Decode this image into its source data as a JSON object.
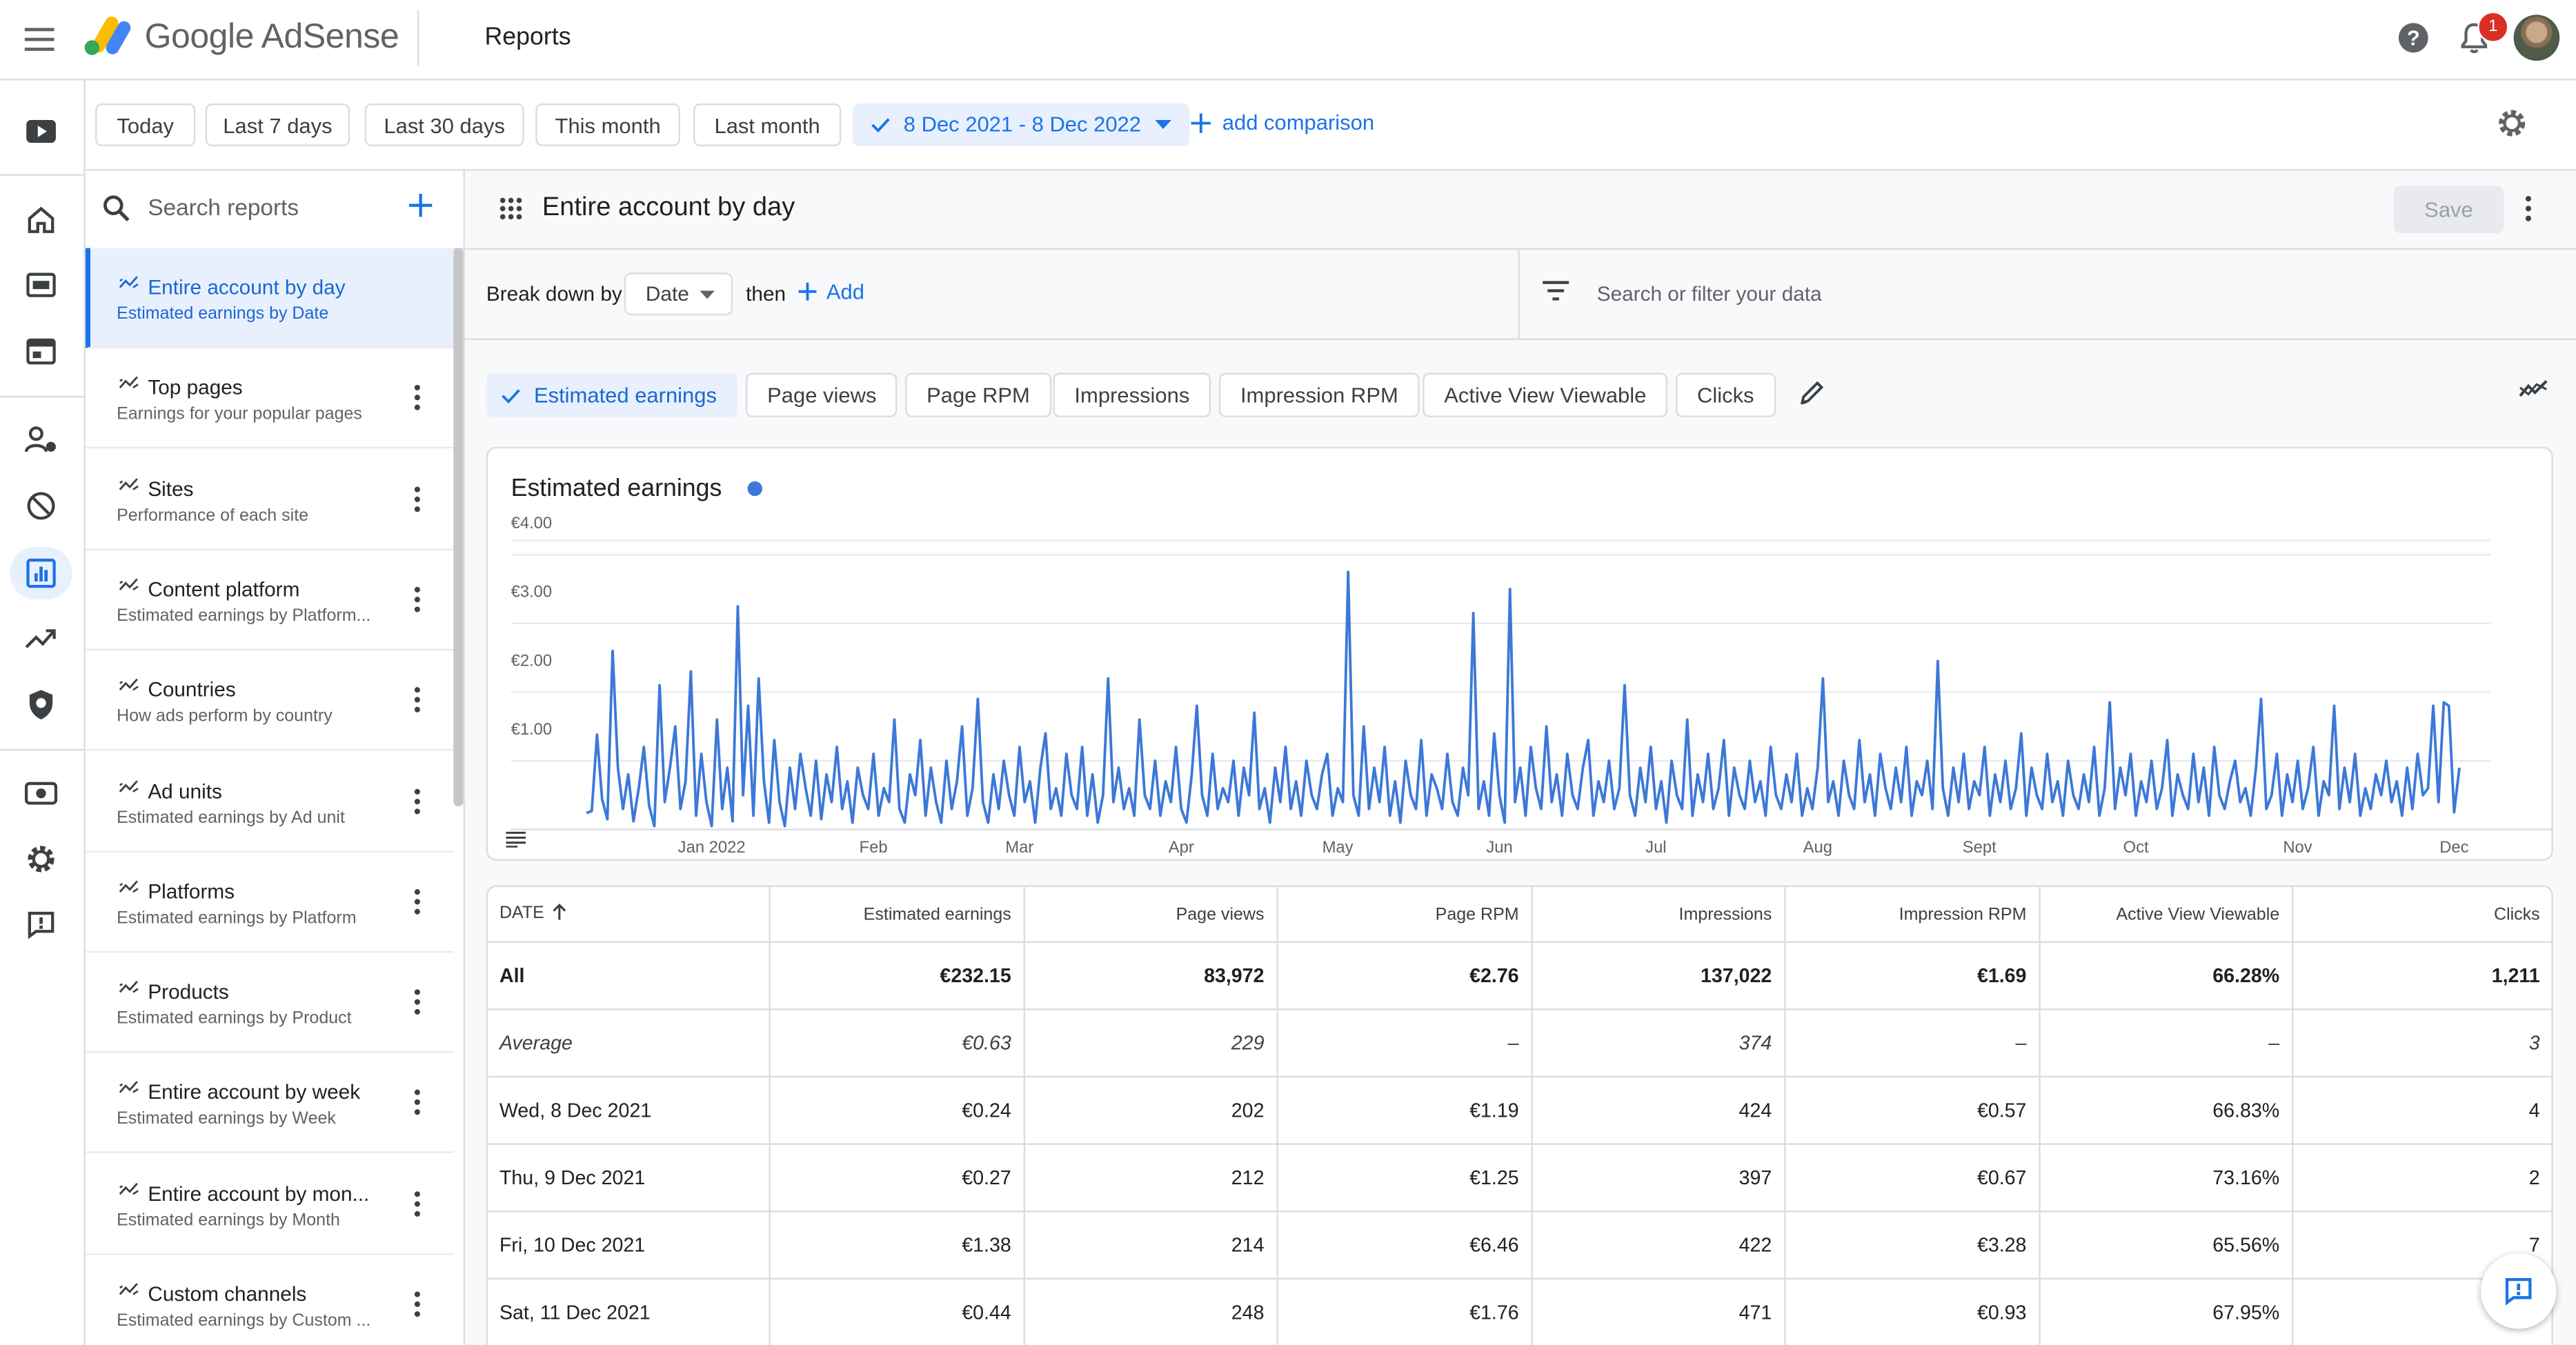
{
  "app": {
    "brand": "Google AdSense",
    "page_title": "Reports",
    "notification_count": "1"
  },
  "rail": {
    "items": [
      "youtube-icon",
      "home-icon",
      "ad-screen-icon",
      "sites-icon",
      "privacy-messaging-icon",
      "blocking-controls-icon",
      "reports-icon",
      "optimization-icon",
      "policy-center-icon",
      "payments-icon",
      "settings-icon",
      "feedback-icon"
    ],
    "active": "reports-icon"
  },
  "datebar": {
    "presets": [
      "Today",
      "Last 7 days",
      "Last 30 days",
      "This month",
      "Last month"
    ],
    "selected_range": "8 Dec 2021 - 8 Dec 2022",
    "add_comparison": "add comparison"
  },
  "reports": {
    "search_placeholder": "Search reports",
    "items": [
      {
        "title": "Entire account by day",
        "subtitle": "Estimated earnings by Date"
      },
      {
        "title": "Top pages",
        "subtitle": "Earnings for your popular pages"
      },
      {
        "title": "Sites",
        "subtitle": "Performance of each site"
      },
      {
        "title": "Content platform",
        "subtitle": "Estimated earnings by Platform..."
      },
      {
        "title": "Countries",
        "subtitle": "How ads perform by country"
      },
      {
        "title": "Ad units",
        "subtitle": "Estimated earnings by Ad unit"
      },
      {
        "title": "Platforms",
        "subtitle": "Estimated earnings by Platform"
      },
      {
        "title": "Products",
        "subtitle": "Estimated earnings by Product"
      },
      {
        "title": "Entire account by week",
        "subtitle": "Estimated earnings by Week"
      },
      {
        "title": "Entire account by mon...",
        "subtitle": "Estimated earnings by Month"
      },
      {
        "title": "Custom channels",
        "subtitle": "Estimated earnings by Custom ..."
      }
    ]
  },
  "report": {
    "name": "Entire account by day",
    "save_label": "Save",
    "breakdown_label": "Break down by",
    "breakdown_value": "Date",
    "then_label": "then",
    "add_label": "Add",
    "filter_placeholder": "Search or filter your data",
    "metrics": [
      "Estimated earnings",
      "Page views",
      "Page RPM",
      "Impressions",
      "Impression RPM",
      "Active View Viewable",
      "Clicks"
    ]
  },
  "chart_data": {
    "type": "line",
    "title": "Estimated earnings",
    "series_color": "#3c78d8",
    "ytick_labels": [
      "€1.00",
      "€2.00",
      "€3.00",
      "€4.00"
    ],
    "ylim": [
      0,
      4.4
    ],
    "xtick_labels": [
      "Jan 2022",
      "Feb",
      "Mar",
      "Apr",
      "May",
      "Jun",
      "Jul",
      "Aug",
      "Sept",
      "Oct",
      "Nov",
      "Dec"
    ],
    "xtick_days": [
      24,
      55,
      83,
      114,
      144,
      175,
      205,
      236,
      267,
      297,
      328,
      358
    ],
    "x_start": "2021-12-08",
    "x_end": "2022-12-08",
    "values": [
      0.24,
      0.27,
      1.38,
      0.44,
      0.15,
      2.6,
      0.9,
      0.3,
      0.8,
      0.12,
      0.6,
      1.2,
      0.35,
      0.05,
      2.1,
      0.4,
      0.9,
      1.5,
      0.3,
      0.7,
      2.3,
      0.2,
      1.1,
      0.4,
      0.05,
      1.6,
      0.3,
      0.9,
      0.12,
      3.25,
      0.5,
      1.8,
      0.2,
      2.2,
      0.7,
      0.1,
      1.3,
      0.4,
      0.05,
      0.9,
      0.3,
      1.1,
      0.6,
      0.2,
      1.0,
      0.15,
      0.8,
      0.4,
      1.2,
      0.3,
      0.7,
      0.1,
      0.9,
      0.5,
      0.3,
      1.1,
      0.2,
      0.6,
      0.4,
      1.6,
      0.3,
      0.1,
      0.8,
      0.5,
      1.3,
      0.2,
      0.9,
      0.4,
      0.1,
      1.0,
      0.3,
      0.7,
      1.5,
      0.2,
      0.6,
      1.9,
      0.4,
      0.1,
      0.8,
      0.3,
      1.0,
      0.5,
      0.2,
      1.2,
      0.4,
      0.7,
      0.1,
      0.9,
      1.4,
      0.3,
      0.6,
      0.2,
      1.1,
      0.5,
      0.3,
      1.2,
      0.2,
      0.8,
      0.1,
      0.5,
      2.2,
      0.4,
      0.9,
      0.3,
      0.6,
      0.2,
      1.6,
      0.5,
      0.3,
      1.0,
      0.2,
      0.7,
      0.4,
      1.2,
      0.3,
      0.1,
      0.8,
      1.8,
      0.5,
      0.2,
      1.1,
      0.3,
      0.6,
      0.4,
      1.0,
      0.2,
      0.9,
      0.5,
      1.7,
      0.3,
      0.6,
      0.1,
      0.9,
      0.4,
      1.2,
      0.3,
      0.7,
      0.2,
      1.0,
      0.5,
      0.3,
      0.8,
      1.1,
      0.2,
      0.6,
      0.4,
      3.75,
      0.5,
      0.2,
      1.5,
      0.3,
      0.9,
      0.4,
      1.2,
      0.2,
      0.7,
      0.1,
      1.0,
      0.5,
      0.3,
      1.3,
      0.2,
      0.8,
      0.6,
      0.3,
      1.1,
      0.4,
      0.2,
      0.9,
      0.5,
      3.15,
      0.3,
      0.7,
      0.2,
      1.4,
      0.5,
      0.1,
      3.5,
      0.4,
      0.9,
      0.2,
      1.2,
      0.6,
      0.3,
      1.5,
      0.4,
      0.8,
      0.2,
      1.1,
      0.5,
      0.3,
      0.9,
      1.3,
      0.2,
      0.7,
      0.4,
      1.0,
      0.3,
      0.6,
      2.1,
      0.5,
      0.2,
      0.9,
      0.4,
      1.2,
      0.3,
      0.7,
      0.1,
      1.0,
      0.5,
      0.3,
      1.6,
      0.2,
      0.8,
      0.4,
      1.1,
      0.3,
      0.6,
      1.3,
      0.2,
      0.9,
      0.5,
      0.3,
      1.0,
      0.4,
      0.7,
      0.2,
      1.2,
      0.5,
      0.3,
      0.8,
      0.4,
      1.1,
      0.2,
      0.6,
      0.3,
      0.9,
      2.2,
      0.4,
      0.7,
      0.2,
      1.0,
      0.5,
      0.3,
      1.3,
      0.4,
      0.8,
      0.2,
      1.1,
      0.6,
      0.3,
      0.9,
      0.4,
      1.2,
      0.2,
      0.7,
      0.5,
      1.0,
      0.3,
      2.45,
      0.6,
      0.2,
      0.9,
      0.4,
      1.1,
      0.3,
      0.7,
      0.5,
      1.2,
      0.2,
      0.8,
      0.4,
      1.0,
      0.3,
      0.6,
      1.4,
      0.2,
      0.9,
      0.5,
      0.3,
      1.1,
      0.4,
      0.7,
      0.2,
      1.0,
      0.5,
      0.3,
      0.8,
      0.4,
      1.2,
      0.2,
      0.6,
      1.85,
      0.3,
      0.9,
      0.5,
      1.1,
      0.2,
      0.7,
      0.4,
      1.0,
      0.3,
      0.6,
      1.3,
      0.2,
      0.8,
      0.5,
      0.3,
      1.1,
      0.4,
      0.9,
      0.2,
      1.2,
      0.5,
      0.3,
      0.7,
      1.0,
      0.4,
      0.6,
      0.2,
      0.9,
      1.9,
      0.3,
      0.5,
      1.1,
      0.2,
      0.8,
      0.4,
      1.0,
      0.3,
      0.6,
      1.2,
      0.2,
      0.7,
      0.5,
      1.8,
      0.3,
      0.9,
      0.4,
      1.1,
      0.2,
      0.6,
      0.3,
      0.8,
      0.5,
      1.0,
      0.4,
      0.7,
      0.2,
      0.9,
      0.3,
      1.1,
      0.5,
      0.6,
      1.8,
      0.4,
      1.85,
      1.8,
      0.25,
      0.9
    ]
  },
  "table": {
    "columns": [
      "DATE",
      "Estimated earnings",
      "Page views",
      "Page RPM",
      "Impressions",
      "Impression RPM",
      "Active View Viewable",
      "Clicks"
    ],
    "rows": [
      [
        "All",
        "€232.15",
        "83,972",
        "€2.76",
        "137,022",
        "€1.69",
        "66.28%",
        "1,211"
      ],
      [
        "Average",
        "€0.63",
        "229",
        "–",
        "374",
        "–",
        "–",
        "3"
      ],
      [
        "Wed, 8 Dec 2021",
        "€0.24",
        "202",
        "€1.19",
        "424",
        "€0.57",
        "66.83%",
        "4"
      ],
      [
        "Thu, 9 Dec 2021",
        "€0.27",
        "212",
        "€1.25",
        "397",
        "€0.67",
        "73.16%",
        "2"
      ],
      [
        "Fri, 10 Dec 2021",
        "€1.38",
        "214",
        "€6.46",
        "422",
        "€3.28",
        "65.56%",
        "7"
      ],
      [
        "Sat, 11 Dec 2021",
        "€0.44",
        "248",
        "€1.76",
        "471",
        "€0.93",
        "67.95%",
        "1"
      ]
    ]
  },
  "colors": {
    "accent": "#1a73e8",
    "chart_line": "#3c78d8",
    "selected_bg": "#e8f0fe",
    "badge": "#d93025"
  }
}
